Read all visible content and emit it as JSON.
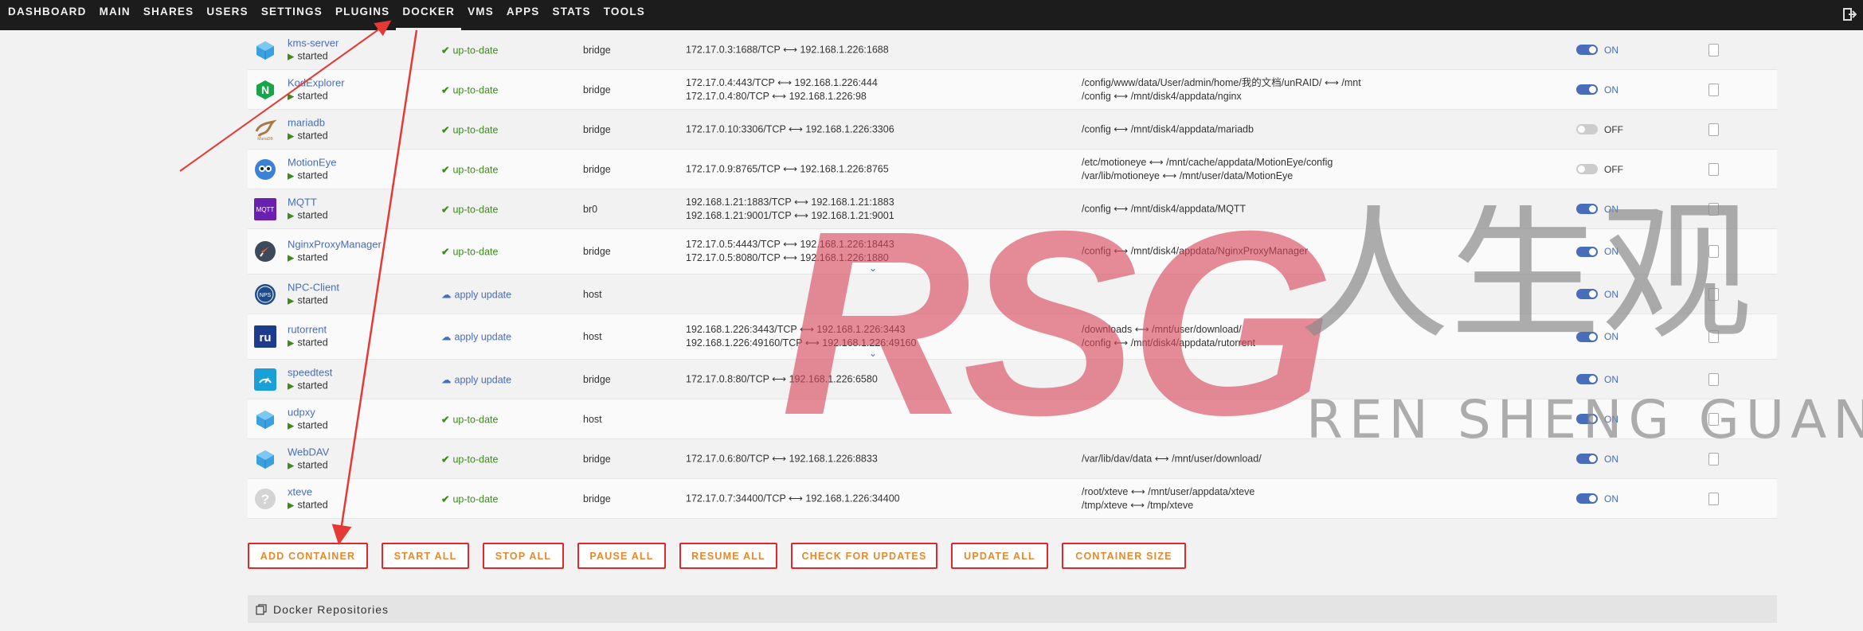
{
  "nav": {
    "items": [
      "DASHBOARD",
      "MAIN",
      "SHARES",
      "USERS",
      "SETTINGS",
      "PLUGINS",
      "DOCKER",
      "VMS",
      "APPS",
      "STATS",
      "TOOLS"
    ],
    "active": "DOCKER"
  },
  "containers": [
    {
      "name": "kms-server",
      "state": "started",
      "version": "up-to-date",
      "network": "bridge",
      "ports": [
        "172.17.0.3:1688/TCP ⟷ 192.168.1.226:1688"
      ],
      "volumes": [],
      "autostart": "ON",
      "icon": "docker-whale-icon"
    },
    {
      "name": "KodExplorer",
      "state": "started",
      "version": "up-to-date",
      "network": "bridge",
      "ports": [
        "172.17.0.4:443/TCP ⟷ 192.168.1.226:444",
        "172.17.0.4:80/TCP ⟷ 192.168.1.226:98"
      ],
      "volumes": [
        "/config/www/data/User/admin/home/我的文档/unRAID/ ⟷ /mnt",
        "/config ⟷ /mnt/disk4/appdata/nginx"
      ],
      "autostart": "ON",
      "icon": "nginx-icon"
    },
    {
      "name": "mariadb",
      "state": "started",
      "version": "up-to-date",
      "network": "bridge",
      "ports": [
        "172.17.0.10:3306/TCP ⟷ 192.168.1.226:3306"
      ],
      "volumes": [
        "/config ⟷ /mnt/disk4/appdata/mariadb"
      ],
      "autostart": "OFF",
      "icon": "mariadb-icon"
    },
    {
      "name": "MotionEye",
      "state": "started",
      "version": "up-to-date",
      "network": "bridge",
      "ports": [
        "172.17.0.9:8765/TCP ⟷ 192.168.1.226:8765"
      ],
      "volumes": [
        "/etc/motioneye ⟷ /mnt/cache/appdata/MotionEye/config",
        "/var/lib/motioneye ⟷ /mnt/user/data/MotionEye"
      ],
      "autostart": "OFF",
      "icon": "motioneye-icon"
    },
    {
      "name": "MQTT",
      "state": "started",
      "version": "up-to-date",
      "network": "br0",
      "ports": [
        "192.168.1.21:1883/TCP ⟷ 192.168.1.21:1883",
        "192.168.1.21:9001/TCP ⟷ 192.168.1.21:9001"
      ],
      "volumes": [
        "/config ⟷ /mnt/disk4/appdata/MQTT"
      ],
      "autostart": "ON",
      "icon": "mqtt-icon"
    },
    {
      "name": "NginxProxyManager",
      "state": "started",
      "version": "up-to-date",
      "network": "bridge",
      "ports": [
        "172.17.0.5:4443/TCP ⟷ 192.168.1.226:18443",
        "172.17.0.5:8080/TCP ⟷ 192.168.1.226:1880"
      ],
      "volumes": [
        "/config ⟷ /mnt/disk4/appdata/NginxProxyManager"
      ],
      "autostart": "ON",
      "icon": "rocket-icon",
      "expand": true
    },
    {
      "name": "NPC-Client",
      "state": "started",
      "version": "apply update",
      "network": "host",
      "ports": [],
      "volumes": [],
      "autostart": "ON",
      "icon": "npc-icon"
    },
    {
      "name": "rutorrent",
      "state": "started",
      "version": "apply update",
      "network": "host",
      "ports": [
        "192.168.1.226:3443/TCP ⟷ 192.168.1.226:3443",
        "192.168.1.226:49160/TCP ⟷ 192.168.1.226:49160"
      ],
      "volumes": [
        "/downloads ⟷ /mnt/user/download/",
        "/config ⟷ /mnt/disk4/appdata/rutorrent"
      ],
      "autostart": "ON",
      "icon": "rutorrent-icon",
      "expand": true
    },
    {
      "name": "speedtest",
      "state": "started",
      "version": "apply update",
      "network": "bridge",
      "ports": [
        "172.17.0.8:80/TCP ⟷ 192.168.1.226:6580"
      ],
      "volumes": [],
      "autostart": "ON",
      "icon": "speedtest-icon"
    },
    {
      "name": "udpxy",
      "state": "started",
      "version": "up-to-date",
      "network": "host",
      "ports": [],
      "volumes": [],
      "autostart": "ON",
      "icon": "docker-whale-icon"
    },
    {
      "name": "WebDAV",
      "state": "started",
      "version": "up-to-date",
      "network": "bridge",
      "ports": [
        "172.17.0.6:80/TCP ⟷ 192.168.1.226:8833"
      ],
      "volumes": [
        "/var/lib/dav/data ⟷ /mnt/user/download/"
      ],
      "autostart": "ON",
      "icon": "docker-whale-icon"
    },
    {
      "name": "xteve",
      "state": "started",
      "version": "up-to-date",
      "network": "bridge",
      "ports": [
        "172.17.0.7:34400/TCP ⟷ 192.168.1.226:34400"
      ],
      "volumes": [
        "/root/xteve ⟷ /mnt/user/appdata/xteve",
        "/tmp/xteve ⟷ /tmp/xteve"
      ],
      "autostart": "ON",
      "icon": "question-icon"
    }
  ],
  "buttons": [
    "ADD CONTAINER",
    "START ALL",
    "STOP ALL",
    "PAUSE ALL",
    "RESUME ALL",
    "CHECK FOR UPDATES",
    "UPDATE ALL",
    "CONTAINER SIZE"
  ],
  "repositories": {
    "label": "Docker Repositories"
  },
  "watermark": {
    "logo": "RSG",
    "cn": "人生观",
    "en": "REN SHENG GUAN"
  },
  "colors": {
    "accent": "#486dba",
    "ok": "#3d8b1d",
    "button_border": "#e22828",
    "button_text": "#e8882a"
  }
}
